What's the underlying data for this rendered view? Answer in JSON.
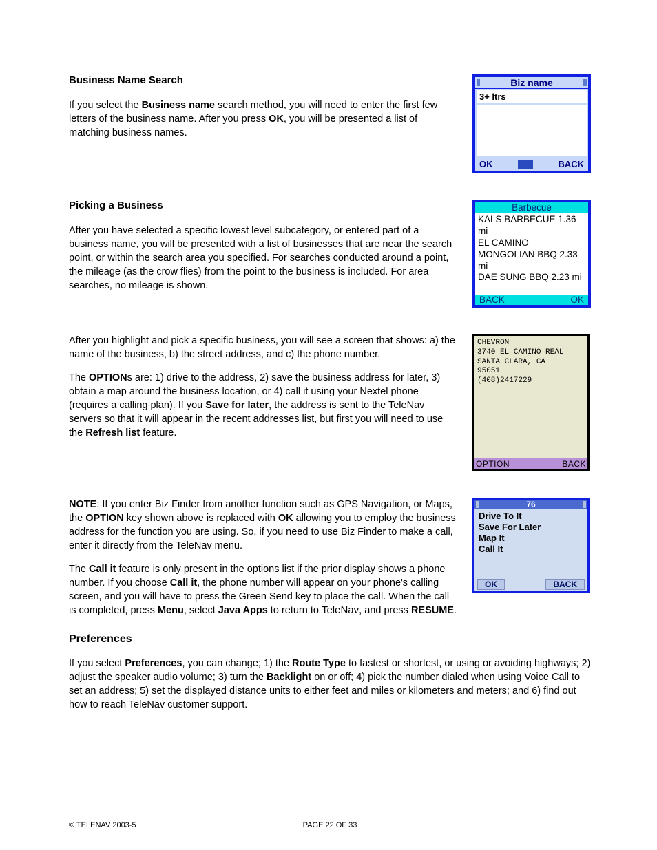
{
  "section1": {
    "heading": "Business Name Search",
    "para_pre": "If you select the ",
    "para_b1": "Business name",
    "para_mid1": " search method, you will need to enter the first few letters of the business name.  After you press ",
    "para_b2": "OK",
    "para_mid2": ", you will be presented a list of matching business names."
  },
  "phone1": {
    "title": "Biz name",
    "hint": "3+ ltrs",
    "ok": "OK",
    "back": "BACK"
  },
  "section2": {
    "heading": "Picking a Business",
    "para": "After you have selected a specific lowest level subcategory, or entered part of a business name, you will be presented with a list of businesses that are near the search point, or within the search area you specified.  For searches conducted around a point, the mileage (as the crow flies) from the point to the business is included.  For area searches, no mileage is shown."
  },
  "phone2": {
    "title": "Barbecue",
    "items": "KALS BARBECUE 1.36 mi\nEL CAMINO MONGOLIAN BBQ 2.33 mi\nDAE SUNG BBQ 2.23 mi",
    "back": "BACK",
    "ok": "OK"
  },
  "section3": {
    "para1": "After you highlight and pick a specific business, you will see a screen that shows: a) the name of the business, b) the street address, and c) the phone number.",
    "p2_pre": "The ",
    "p2_b1": "OPTION",
    "p2_mid1": "s are: 1) drive to the address, 2) save the business address for later, 3) obtain a map around the business location, or 4) call it using your Nextel phone (requires a calling plan).  If you ",
    "p2_b2": "Save for later",
    "p2_mid2": ", the address is sent to the TeleNav servers so that it will appear in the recent addresses list, but first you will need to use the ",
    "p2_b3": "Refresh list",
    "p2_end": " feature."
  },
  "phone3": {
    "body": "CHEVRON\n3740 EL CAMINO REAL\nSANTA CLARA, CA\n 95051\n(408)2417229",
    "option": "OPTION",
    "back": "BACK"
  },
  "section4": {
    "p1_b1": "NOTE",
    "p1_mid1": ": If you enter Biz Finder from another function such as GPS Navigation, or Maps, the ",
    "p1_b2": "OPTION",
    "p1_mid2": " key shown above is replaced with ",
    "p1_b3": "OK",
    "p1_mid3": " allowing you to employ the business address for the function you are using.  So, if you need to use Biz Finder to make a call, enter it directly from the TeleNav menu.",
    "p2_pre": "The ",
    "p2_b1": "Call it",
    "p2_mid1": " feature is only present in the options list if the prior display shows a phone number.  If you choose ",
    "p2_b2": "Call it",
    "p2_mid2": ", the phone number will appear on your phone's calling screen, and you will have to press the Green Send key to place the call.  When the call is completed, press ",
    "p2_b3": "Menu",
    "p2_mid3": ", select ",
    "p2_b4": "Java Apps",
    "p2_mid4": " to return to ",
    "p2_tn": "TeleNav",
    "p2_mid5": ", and press ",
    "p2_b5": "RESUME",
    "p2_end": "."
  },
  "phone4": {
    "title": "76",
    "opt1": "Drive To It",
    "opt2": "Save For Later",
    "opt3": "Map It",
    "opt4": "Call It",
    "ok": "OK",
    "back": "BACK"
  },
  "section5": {
    "heading": "Preferences",
    "p_pre": "If you select ",
    "p_b1": "Preferences",
    "p_mid1": ", you can change; 1) the ",
    "p_b2": "Route Type",
    "p_mid2": " to fastest or shortest, or using or avoiding highways; 2) adjust the speaker audio volume; 3) turn the ",
    "p_b3": "Backlight",
    "p_mid3": " on or off; 4) pick the number dialed when using Voice Call to set an address; 5) set the displayed distance units to either feet and miles or kilometers and meters; and 6) find out how to reach TeleNav customer support."
  },
  "footer": {
    "left": "© TELENAV 2003-5",
    "center": "PAGE 22 OF 33"
  }
}
